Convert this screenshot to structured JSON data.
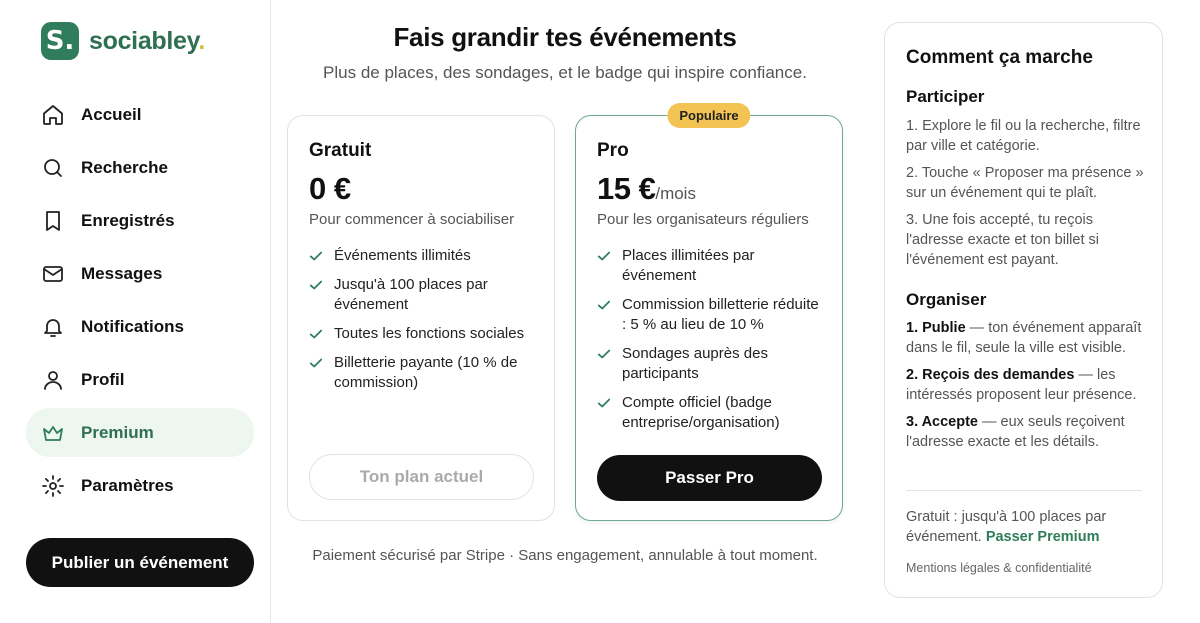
{
  "brand": {
    "mark": "S.",
    "name": "sociabley",
    "dot": "."
  },
  "sidebar": {
    "items": [
      {
        "label": "Accueil",
        "icon": "home-icon"
      },
      {
        "label": "Recherche",
        "icon": "search-icon"
      },
      {
        "label": "Enregistrés",
        "icon": "bookmark-icon"
      },
      {
        "label": "Messages",
        "icon": "mail-icon"
      },
      {
        "label": "Notifications",
        "icon": "bell-icon"
      },
      {
        "label": "Profil",
        "icon": "user-icon"
      },
      {
        "label": "Premium",
        "icon": "crown-icon",
        "active": true
      },
      {
        "label": "Paramètres",
        "icon": "gear-icon"
      }
    ],
    "publish_label": "Publier un événement"
  },
  "main": {
    "title": "Fais grandir tes événements",
    "subtitle": "Plus de places, des sondages, et le badge qui inspire confiance.",
    "plans": {
      "free": {
        "name": "Gratuit",
        "price": "0 €",
        "description": "Pour commencer à sociabiliser",
        "features": [
          "Événements illimités",
          "Jusqu'à 100 places par événement",
          "Toutes les fonctions sociales",
          "Billetterie payante (10 % de commission)"
        ],
        "button": "Ton plan actuel"
      },
      "pro": {
        "badge": "Populaire",
        "name": "Pro",
        "price": "15 €",
        "period": "/mois",
        "description": "Pour les organisateurs réguliers",
        "features": [
          "Places illimitées par événement",
          "Commission billetterie réduite : 5 % au lieu de 10 %",
          "Sondages auprès des participants",
          "Compte officiel (badge entreprise/organisation)"
        ],
        "button": "Passer Pro"
      }
    },
    "footnote": "Paiement sécurisé par Stripe · Sans engagement, annulable à tout moment."
  },
  "how_it_works": {
    "title": "Comment ça marche",
    "participate": {
      "title": "Participer",
      "steps": [
        "1. Explore le fil ou la recherche, filtre par ville et catégorie.",
        "2. Touche « Proposer ma présence » sur un événement qui te plaît.",
        "3. Une fois accepté, tu reçois l'adresse exacte et ton billet si l'événement est payant."
      ]
    },
    "organize": {
      "title": "Organiser",
      "steps": [
        {
          "bold": "1. Publie",
          "text": " — ton événement apparaît dans le fil, seule la ville est visible."
        },
        {
          "bold": "2. Reçois des demandes",
          "text": " — les intéressés proposent leur présence."
        },
        {
          "bold": "3. Accepte",
          "text": " — eux seuls reçoivent l'adresse exacte et les détails."
        }
      ]
    },
    "free_note": "Gratuit : jusqu'à 100 places par événement.",
    "free_link": "Passer Premium",
    "legal": "Mentions légales & confidentialité"
  },
  "colors": {
    "brand_green": "#2f7d5a",
    "badge_yellow": "#f3c453",
    "active_bg": "#eef6f0"
  }
}
